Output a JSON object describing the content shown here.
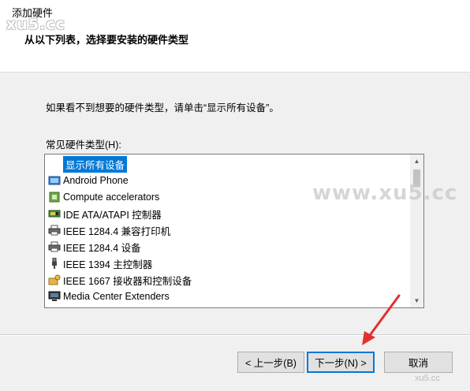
{
  "window": {
    "title": "添加硬件"
  },
  "watermark": {
    "top": "xu5.cc",
    "middle": "www.xu5.cc",
    "bottom": "xu5.cc"
  },
  "header": {
    "subtitle": "从以下列表，选择要安装的硬件类型"
  },
  "body": {
    "instruction": "如果看不到想要的硬件类型，请单击“显示所有设备”。",
    "list_label": "常见硬件类型(H):"
  },
  "list": {
    "items": [
      {
        "label": "显示所有设备",
        "icon": "none",
        "selected": true
      },
      {
        "label": "Android Phone",
        "icon": "phone-icon"
      },
      {
        "label": "Compute accelerators",
        "icon": "chip-icon"
      },
      {
        "label": "IDE ATA/ATAPI 控制器",
        "icon": "ide-controller-icon"
      },
      {
        "label": "IEEE 1284.4 兼容打印机",
        "icon": "printer-icon"
      },
      {
        "label": "IEEE 1284.4 设备",
        "icon": "printer-icon"
      },
      {
        "label": "IEEE 1394 主控制器",
        "icon": "usb-plug-icon"
      },
      {
        "label": "IEEE 1667 接收器和控制设备",
        "icon": "folder-key-icon"
      },
      {
        "label": "Media Center Extenders",
        "icon": "monitor-icon"
      }
    ]
  },
  "buttons": {
    "back": "< 上一步(B)",
    "next": "下一步(N) >",
    "cancel": "取消"
  },
  "colors": {
    "accent": "#0078d7",
    "arrow": "#e0312e"
  }
}
